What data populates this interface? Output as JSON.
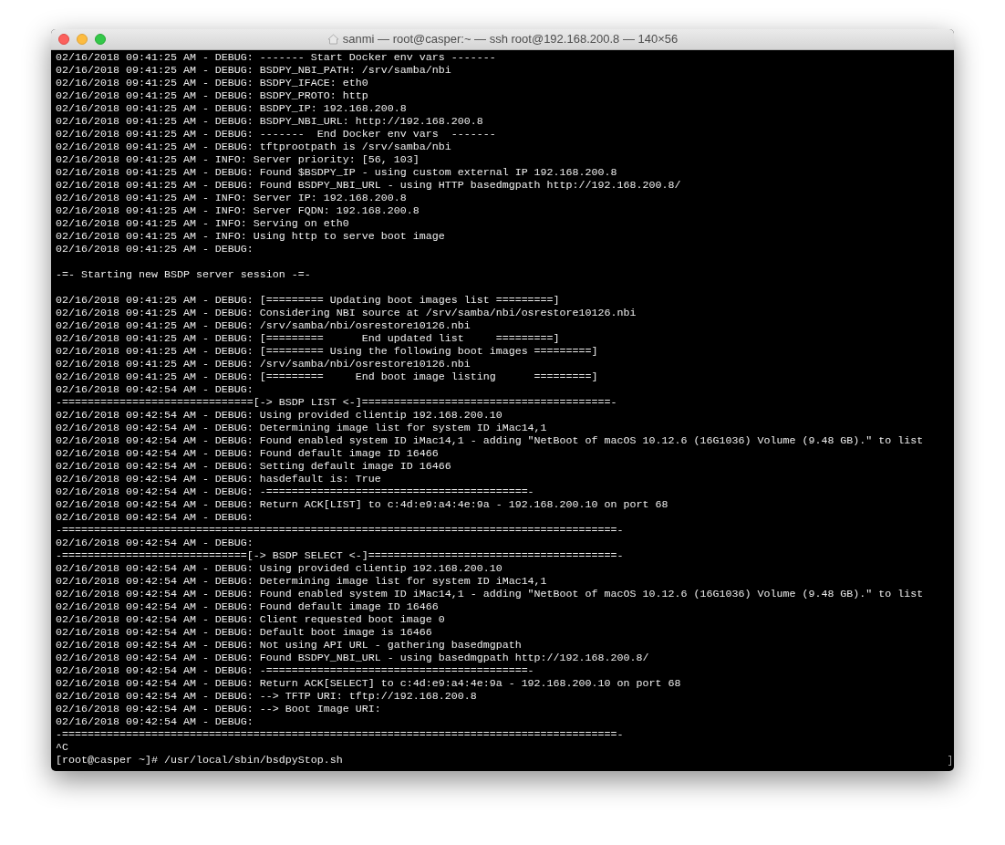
{
  "window": {
    "title": "sanmi — root@casper:~ — ssh root@192.168.200.8 — 140×56"
  },
  "terminal": {
    "lines": [
      {
        "kind": "log",
        "text": "02/16/2018 09:41:25 AM - DEBUG: ------- Start Docker env vars -------"
      },
      {
        "kind": "log",
        "text": "02/16/2018 09:41:25 AM - DEBUG: BSDPY_NBI_PATH: /srv/samba/nbi"
      },
      {
        "kind": "log",
        "text": "02/16/2018 09:41:25 AM - DEBUG: BSDPY_IFACE: eth0"
      },
      {
        "kind": "log",
        "text": "02/16/2018 09:41:25 AM - DEBUG: BSDPY_PROTO: http"
      },
      {
        "kind": "log",
        "text": "02/16/2018 09:41:25 AM - DEBUG: BSDPY_IP: 192.168.200.8"
      },
      {
        "kind": "log",
        "text": "02/16/2018 09:41:25 AM - DEBUG: BSDPY_NBI_URL: http://192.168.200.8"
      },
      {
        "kind": "log",
        "text": "02/16/2018 09:41:25 AM - DEBUG: -------  End Docker env vars  -------"
      },
      {
        "kind": "log",
        "text": "02/16/2018 09:41:25 AM - DEBUG: tftprootpath is /srv/samba/nbi"
      },
      {
        "kind": "log",
        "text": "02/16/2018 09:41:25 AM - INFO: Server priority: [56, 103]"
      },
      {
        "kind": "log",
        "text": "02/16/2018 09:41:25 AM - DEBUG: Found $BSDPY_IP - using custom external IP 192.168.200.8"
      },
      {
        "kind": "log",
        "text": "02/16/2018 09:41:25 AM - DEBUG: Found BSDPY_NBI_URL - using HTTP basedmgpath http://192.168.200.8/"
      },
      {
        "kind": "log",
        "text": "02/16/2018 09:41:25 AM - INFO: Server IP: 192.168.200.8"
      },
      {
        "kind": "log",
        "text": "02/16/2018 09:41:25 AM - INFO: Server FQDN: 192.168.200.8"
      },
      {
        "kind": "log",
        "text": "02/16/2018 09:41:25 AM - INFO: Serving on eth0"
      },
      {
        "kind": "log",
        "text": "02/16/2018 09:41:25 AM - INFO: Using http to serve boot image"
      },
      {
        "kind": "log",
        "text": "02/16/2018 09:41:25 AM - DEBUG:"
      },
      {
        "kind": "spaced",
        "text": "-=- Starting new BSDP server session -=-"
      },
      {
        "kind": "log",
        "text": "02/16/2018 09:41:25 AM - DEBUG: [========= Updating boot images list =========]"
      },
      {
        "kind": "log",
        "text": "02/16/2018 09:41:25 AM - DEBUG: Considering NBI source at /srv/samba/nbi/osrestore10126.nbi"
      },
      {
        "kind": "log",
        "text": "02/16/2018 09:41:25 AM - DEBUG: /srv/samba/nbi/osrestore10126.nbi"
      },
      {
        "kind": "log",
        "text": "02/16/2018 09:41:25 AM - DEBUG: [=========      End updated list     =========]"
      },
      {
        "kind": "log",
        "text": "02/16/2018 09:41:25 AM - DEBUG: [========= Using the following boot images =========]"
      },
      {
        "kind": "log",
        "text": "02/16/2018 09:41:25 AM - DEBUG: /srv/samba/nbi/osrestore10126.nbi"
      },
      {
        "kind": "log",
        "text": "02/16/2018 09:41:25 AM - DEBUG: [=========     End boot image listing      =========]"
      },
      {
        "kind": "log",
        "text": "02/16/2018 09:42:54 AM - DEBUG:"
      },
      {
        "kind": "log",
        "text": "-==============================[-> BSDP LIST <-]=======================================-"
      },
      {
        "kind": "log",
        "text": "02/16/2018 09:42:54 AM - DEBUG: Using provided clientip 192.168.200.10"
      },
      {
        "kind": "log",
        "text": "02/16/2018 09:42:54 AM - DEBUG: Determining image list for system ID iMac14,1"
      },
      {
        "kind": "log",
        "text": "02/16/2018 09:42:54 AM - DEBUG: Found enabled system ID iMac14,1 - adding \"NetBoot of macOS 10.12.6 (16G1036) Volume (9.48 GB).\" to list"
      },
      {
        "kind": "log",
        "text": "02/16/2018 09:42:54 AM - DEBUG: Found default image ID 16466"
      },
      {
        "kind": "log",
        "text": "02/16/2018 09:42:54 AM - DEBUG: Setting default image ID 16466"
      },
      {
        "kind": "log",
        "text": "02/16/2018 09:42:54 AM - DEBUG: hasdefault is: True"
      },
      {
        "kind": "log",
        "text": "02/16/2018 09:42:54 AM - DEBUG: -=========================================-"
      },
      {
        "kind": "log",
        "text": "02/16/2018 09:42:54 AM - DEBUG: Return ACK[LIST] to c:4d:e9:a4:4e:9a - 192.168.200.10 on port 68"
      },
      {
        "kind": "log",
        "text": "02/16/2018 09:42:54 AM - DEBUG:"
      },
      {
        "kind": "log",
        "text": "-=======================================================================================-"
      },
      {
        "kind": "log",
        "text": "02/16/2018 09:42:54 AM - DEBUG:"
      },
      {
        "kind": "log",
        "text": "-=============================[-> BSDP SELECT <-]=======================================-"
      },
      {
        "kind": "log",
        "text": "02/16/2018 09:42:54 AM - DEBUG: Using provided clientip 192.168.200.10"
      },
      {
        "kind": "log",
        "text": "02/16/2018 09:42:54 AM - DEBUG: Determining image list for system ID iMac14,1"
      },
      {
        "kind": "log",
        "text": "02/16/2018 09:42:54 AM - DEBUG: Found enabled system ID iMac14,1 - adding \"NetBoot of macOS 10.12.6 (16G1036) Volume (9.48 GB).\" to list"
      },
      {
        "kind": "log",
        "text": "02/16/2018 09:42:54 AM - DEBUG: Found default image ID 16466"
      },
      {
        "kind": "log",
        "text": "02/16/2018 09:42:54 AM - DEBUG: Client requested boot image 0"
      },
      {
        "kind": "log",
        "text": "02/16/2018 09:42:54 AM - DEBUG: Default boot image is 16466"
      },
      {
        "kind": "log",
        "text": "02/16/2018 09:42:54 AM - DEBUG: Not using API URL - gathering basedmgpath"
      },
      {
        "kind": "log",
        "text": "02/16/2018 09:42:54 AM - DEBUG: Found BSDPY_NBI_URL - using basedmgpath http://192.168.200.8/"
      },
      {
        "kind": "log",
        "text": "02/16/2018 09:42:54 AM - DEBUG: -=========================================-"
      },
      {
        "kind": "log",
        "text": "02/16/2018 09:42:54 AM - DEBUG: Return ACK[SELECT] to c:4d:e9:a4:4e:9a - 192.168.200.10 on port 68"
      },
      {
        "kind": "log",
        "text": "02/16/2018 09:42:54 AM - DEBUG: --> TFTP URI: tftp://192.168.200.8"
      },
      {
        "kind": "log",
        "text": "02/16/2018 09:42:54 AM - DEBUG: --> Boot Image URI:"
      },
      {
        "kind": "log",
        "text": "02/16/2018 09:42:54 AM - DEBUG:"
      },
      {
        "kind": "log",
        "text": "-=======================================================================================-"
      },
      {
        "kind": "log",
        "text": "^C"
      },
      {
        "kind": "prompt",
        "text": "[root@casper ~]# /usr/local/sbin/bsdpyStop.sh"
      }
    ]
  }
}
